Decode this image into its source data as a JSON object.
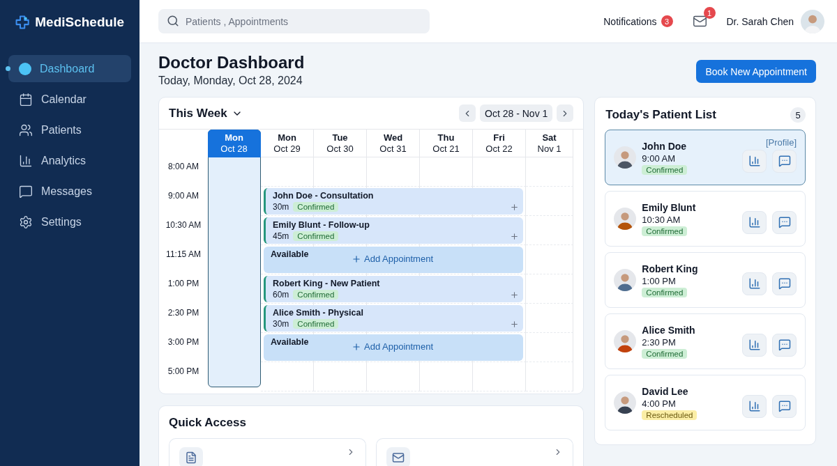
{
  "brand": {
    "name": "MediSchedule"
  },
  "sidebar": {
    "items": [
      {
        "label": "Dashboard",
        "selected": true
      },
      {
        "label": "Calendar",
        "selected": false
      },
      {
        "label": "Patients",
        "selected": false
      },
      {
        "label": "Analytics",
        "selected": false
      },
      {
        "label": "Messages",
        "selected": false
      },
      {
        "label": "Settings",
        "selected": false
      }
    ]
  },
  "header": {
    "search": {
      "placeholder": "Patients , Appointments"
    },
    "notifications": {
      "label": "Notifications",
      "count": "3"
    },
    "messages": {
      "count": "1"
    },
    "user": {
      "name": "Dr. Sarah Chen"
    }
  },
  "page": {
    "title": "Doctor Dashboard",
    "subtitle": "Today, Monday, Oct 28, 2024",
    "action": "Book New Appointment"
  },
  "calendar": {
    "view": "This Week",
    "range": "Oct 28 - Nov 1",
    "days": [
      {
        "day": "Mon",
        "date": "Oct 28",
        "selected": true
      },
      {
        "day": "Mon",
        "date": "Oct 29",
        "selected": false
      },
      {
        "day": "Tue",
        "date": "Oct 30",
        "selected": false
      },
      {
        "day": "Wed",
        "date": "Oct 31",
        "selected": false
      },
      {
        "day": "Thu",
        "date": "Oct 21",
        "selected": false
      },
      {
        "day": "Fri",
        "date": "Oct 22",
        "selected": false
      },
      {
        "day": "Sat",
        "date": "Nov 1",
        "selected": false
      }
    ],
    "slots": [
      {
        "time": "8:00 AM"
      },
      {
        "time": "9:00 AM",
        "event": {
          "kind": "appointment",
          "title": "John Doe - Consultation",
          "duration": "30m",
          "status": "Confirmed"
        }
      },
      {
        "time": "10:30 AM",
        "event": {
          "kind": "appointment",
          "title": "Emily Blunt - Follow-up",
          "duration": "45m",
          "status": "Confirmed"
        }
      },
      {
        "time": "11:15 AM",
        "event": {
          "kind": "available",
          "title": "Available",
          "action": "Add Appointment"
        }
      },
      {
        "time": "1:00 PM",
        "event": {
          "kind": "appointment",
          "title": "Robert King - New Patient",
          "duration": "60m",
          "status": "Confirmed"
        }
      },
      {
        "time": "2:30 PM",
        "event": {
          "kind": "appointment",
          "title": "Alice Smith - Physical",
          "duration": "30m",
          "status": "Confirmed"
        }
      },
      {
        "time": "3:00 PM",
        "event": {
          "kind": "available",
          "title": "Available",
          "action": "Add Appointment"
        }
      },
      {
        "time": "5:00 PM"
      }
    ]
  },
  "quick_access": {
    "title": "Quick Access"
  },
  "patient_list": {
    "title": "Today's Patient List",
    "count": "5",
    "patients": [
      {
        "name": "John Doe",
        "time": "9:00 AM",
        "status": {
          "label": "Confirmed",
          "kind": "confirmed"
        },
        "selected": true,
        "link": "[Profile]"
      },
      {
        "name": "Emily Blunt",
        "time": "10:30 AM",
        "status": {
          "label": "Confirmed",
          "kind": "confirmed"
        },
        "selected": false
      },
      {
        "name": "Robert King",
        "time": "1:00 PM",
        "status": {
          "label": "Confirmed",
          "kind": "confirmed"
        },
        "selected": false
      },
      {
        "name": "Alice Smith",
        "time": "2:30 PM",
        "status": {
          "label": "Confirmed",
          "kind": "confirmed"
        },
        "selected": false
      },
      {
        "name": "David Lee",
        "time": "4:00 PM",
        "status": {
          "label": "Rescheduled",
          "kind": "rescheduled"
        },
        "selected": false
      }
    ]
  }
}
